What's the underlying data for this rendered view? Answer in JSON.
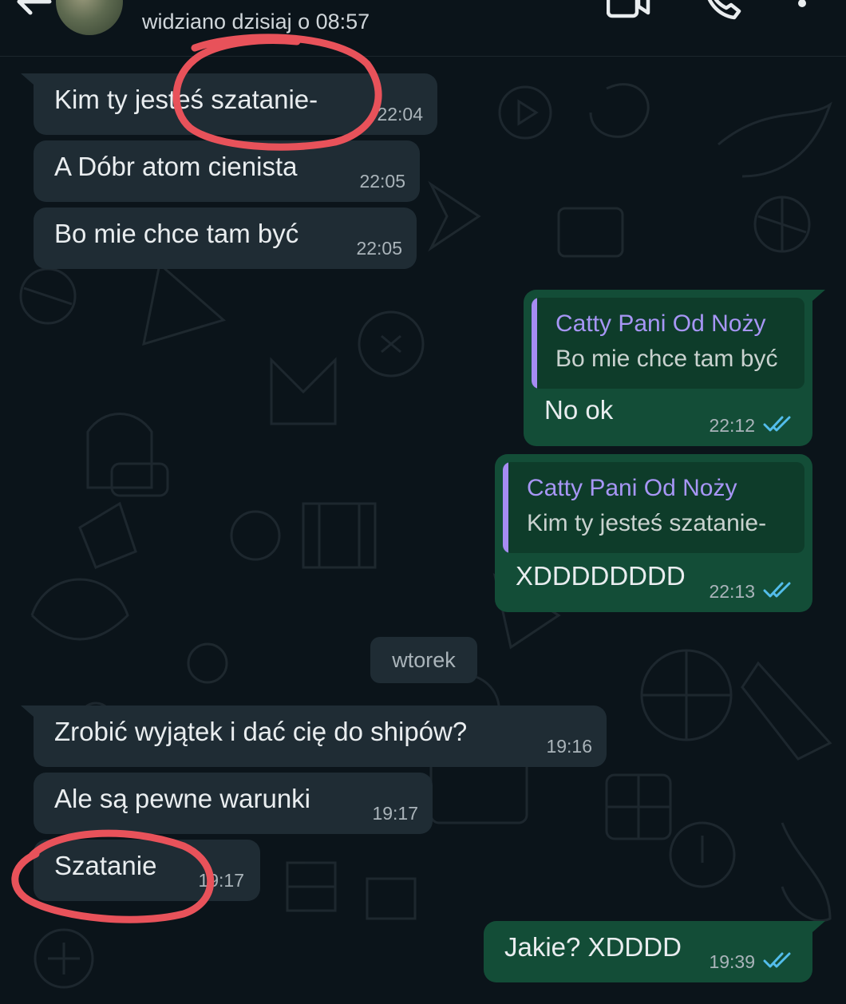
{
  "header": {
    "last_seen": "widziano dzisiaj o 08:57",
    "icons": [
      "back-arrow-icon",
      "video-call-icon",
      "phone-icon",
      "more-options-icon"
    ]
  },
  "colors": {
    "background": "#0b141a",
    "incoming_bubble": "#1f2c34",
    "outgoing_bubble": "#134d37",
    "quote_name": "#a796f5",
    "read_ticks": "#53bdeb",
    "annotation": "#e8525a"
  },
  "messages": [
    {
      "text": "Kim ty jesteś szatanie-",
      "time": "22:04"
    },
    {
      "text": "A Dóbr atom cienista",
      "time": "22:05"
    },
    {
      "text": "Bo mie chce tam być",
      "time": "22:05"
    },
    {
      "text": "No ok",
      "time": "22:12",
      "quote_name": "Catty Pani Od Noży",
      "quote_text": "Bo mie chce tam być"
    },
    {
      "text": "XDDDDDDDD",
      "time": "22:13",
      "quote_name": "Catty Pani Od Noży",
      "quote_text": "Kim ty jesteś szatanie-"
    },
    {
      "text": "Zrobić wyjątek i dać cię do shipów?",
      "time": "19:16"
    },
    {
      "text": "Ale są pewne warunki",
      "time": "19:17"
    },
    {
      "text": "Szatanie",
      "time": "19:17"
    },
    {
      "text": "Jakie? XDDDD",
      "time": "19:39"
    }
  ],
  "date_separator": "wtorek"
}
